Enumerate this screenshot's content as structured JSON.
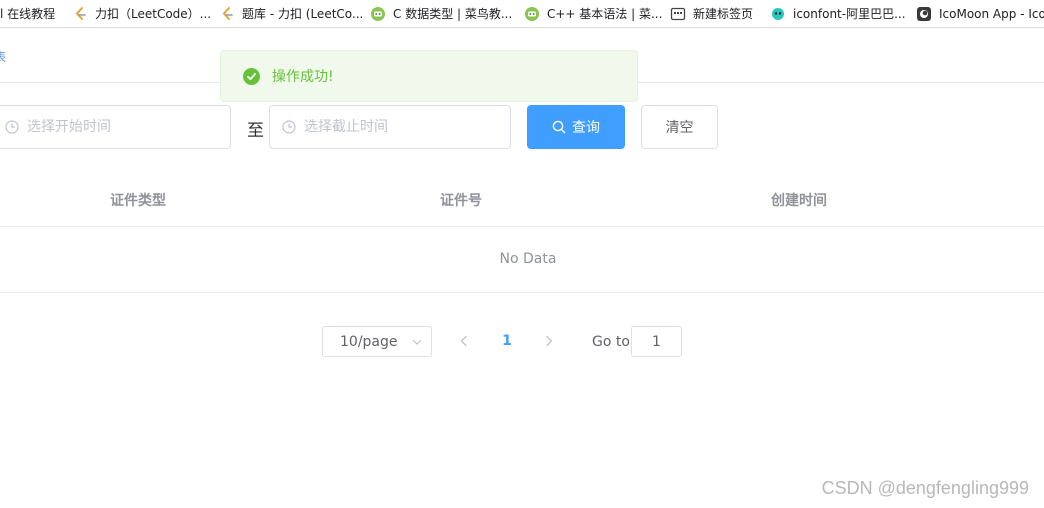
{
  "bookmarks": [
    {
      "label": "l 在线教程",
      "icon": "page-icon"
    },
    {
      "label": "力扣（LeetCode）...",
      "icon": "leetcode-icon"
    },
    {
      "label": "题库 - 力扣 (LeetCo...",
      "icon": "leetcode-icon"
    },
    {
      "label": "C 数据类型 | 菜鸟教...",
      "icon": "runoob-icon"
    },
    {
      "label": "C++ 基本语法 | 菜...",
      "icon": "runoob-icon"
    },
    {
      "label": "新建标签页",
      "icon": "new-tab-icon"
    },
    {
      "label": "iconfont-阿里巴巴...",
      "icon": "iconfont-icon"
    },
    {
      "label": "IcoMoon App - Ico...",
      "icon": "icomoon-icon"
    }
  ],
  "breadcrumb": "表",
  "toast": {
    "message": "操作成功!",
    "color": "#67c23a"
  },
  "search": {
    "start_placeholder": "选择开始时间",
    "separator": "至",
    "end_placeholder": "选择截止时间",
    "query_label": "查询",
    "clear_label": "清空",
    "accent": "#409eff"
  },
  "table": {
    "columns": [
      "证件类型",
      "证件号",
      "创建时间"
    ],
    "empty_text": "No Data"
  },
  "pagination": {
    "page_size": "10/page",
    "current_page": "1",
    "goto_label": "Go to",
    "goto_value": "1"
  },
  "watermark": "CSDN @dengfengling999"
}
